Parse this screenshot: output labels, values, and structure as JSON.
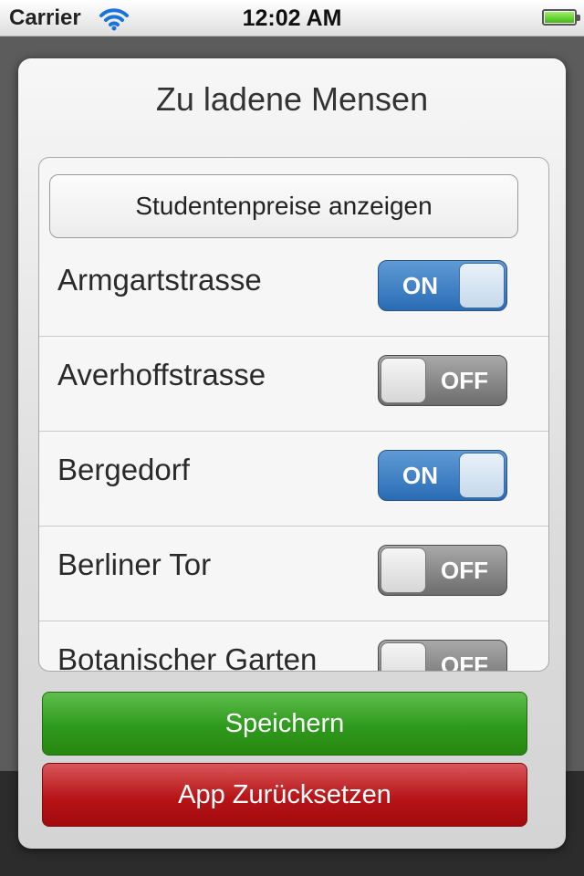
{
  "status_bar": {
    "carrier": "Carrier",
    "time": "12:02 AM",
    "icons": [
      "wifi-icon",
      "battery-icon"
    ]
  },
  "dialog": {
    "title": "Zu ladene Mensen",
    "student_prices_button": "Studentenpreise anzeigen",
    "mensen": [
      {
        "name": "Armgartstrasse",
        "toggle": "ON",
        "enabled": true
      },
      {
        "name": "Averhoffstrasse",
        "toggle": "OFF",
        "enabled": false
      },
      {
        "name": "Bergedorf",
        "toggle": "ON",
        "enabled": true
      },
      {
        "name": "Berliner Tor",
        "toggle": "OFF",
        "enabled": false
      },
      {
        "name": "Botanischer Garten",
        "toggle": "OFF",
        "enabled": false
      }
    ],
    "save_button": "Speichern",
    "reset_button": "App Zurücksetzen"
  },
  "colors": {
    "toggle_on": "#2a6cb5",
    "toggle_off": "#6c6c6c",
    "save": "#2e9a1d",
    "reset": "#b71518"
  }
}
